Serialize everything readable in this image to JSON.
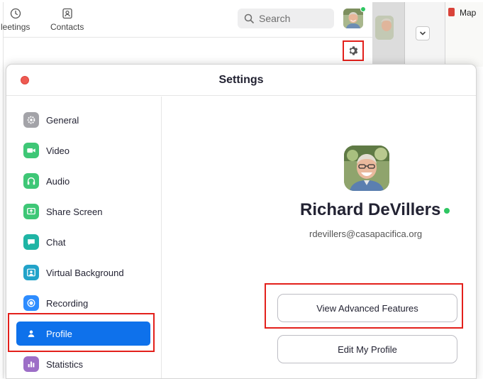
{
  "main_window": {
    "nav": {
      "meetings_label": "leetings",
      "contacts_label": "Contacts"
    },
    "search": {
      "placeholder": "Search"
    },
    "colors": {
      "highlight": "#e3201b",
      "online": "#2ec662"
    }
  },
  "background": {
    "maps_label": "Map"
  },
  "settings": {
    "title": "Settings",
    "sidebar": {
      "items": [
        {
          "label": "General",
          "icon": "gear-icon",
          "color": "#a3a3a8"
        },
        {
          "label": "Video",
          "icon": "video-camera-icon",
          "color": "#3ec776"
        },
        {
          "label": "Audio",
          "icon": "headphones-icon",
          "color": "#3ec776"
        },
        {
          "label": "Share Screen",
          "icon": "share-screen-icon",
          "color": "#3ec776"
        },
        {
          "label": "Chat",
          "icon": "chat-bubble-icon",
          "color": "#1fb5a5"
        },
        {
          "label": "Virtual Background",
          "icon": "person-frame-icon",
          "color": "#22a3c9"
        },
        {
          "label": "Recording",
          "icon": "record-icon",
          "color": "#2d8cff"
        },
        {
          "label": "Profile",
          "icon": "person-icon",
          "color": "#0e71eb",
          "active": true
        },
        {
          "label": "Statistics",
          "icon": "bar-chart-icon",
          "color": "#9d6ec7"
        }
      ]
    },
    "profile": {
      "name": "Richard DeVillers",
      "email": "rdevillers@casapacifica.org",
      "view_advanced_label": "View Advanced Features",
      "edit_profile_label": "Edit My Profile"
    }
  }
}
